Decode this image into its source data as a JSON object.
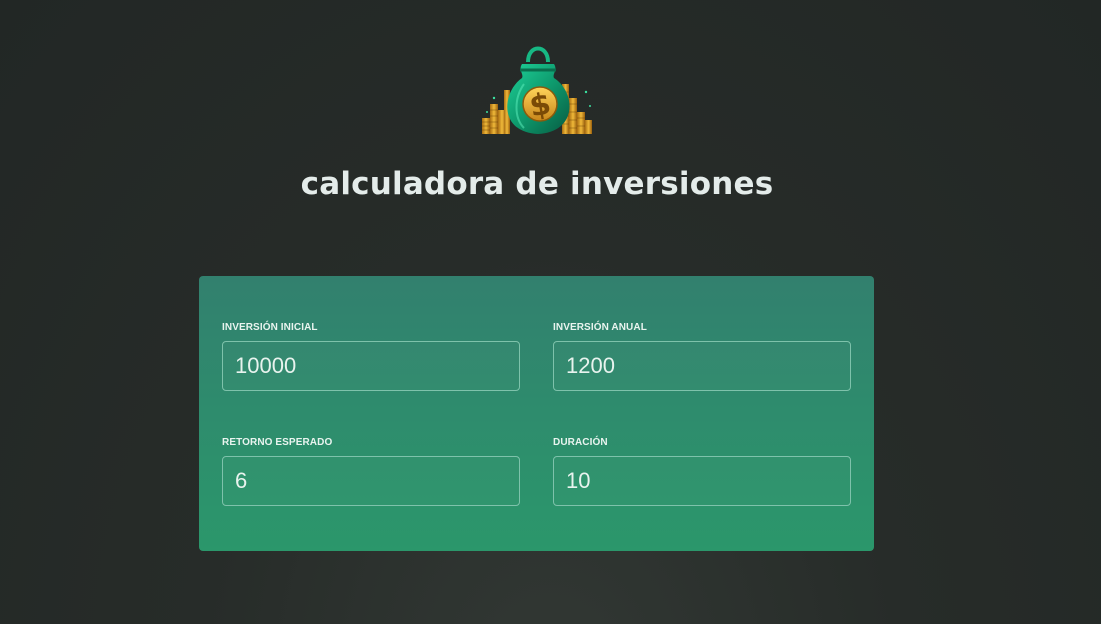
{
  "header": {
    "title": "calculadora de inversiones",
    "logo_icon": "money-bag-icon"
  },
  "form": {
    "fields": [
      {
        "label": "INVERSIÓN INICIAL",
        "value": "10000"
      },
      {
        "label": "INVERSIÓN ANUAL",
        "value": "1200"
      },
      {
        "label": "RETORNO ESPERADO",
        "value": "6"
      },
      {
        "label": "DURACIÓN",
        "value": "10"
      }
    ]
  },
  "colors": {
    "background": "#252a27",
    "card": "#2e8c6d",
    "title_text": "#e4ecea",
    "input_border": "#7ec2ab"
  }
}
